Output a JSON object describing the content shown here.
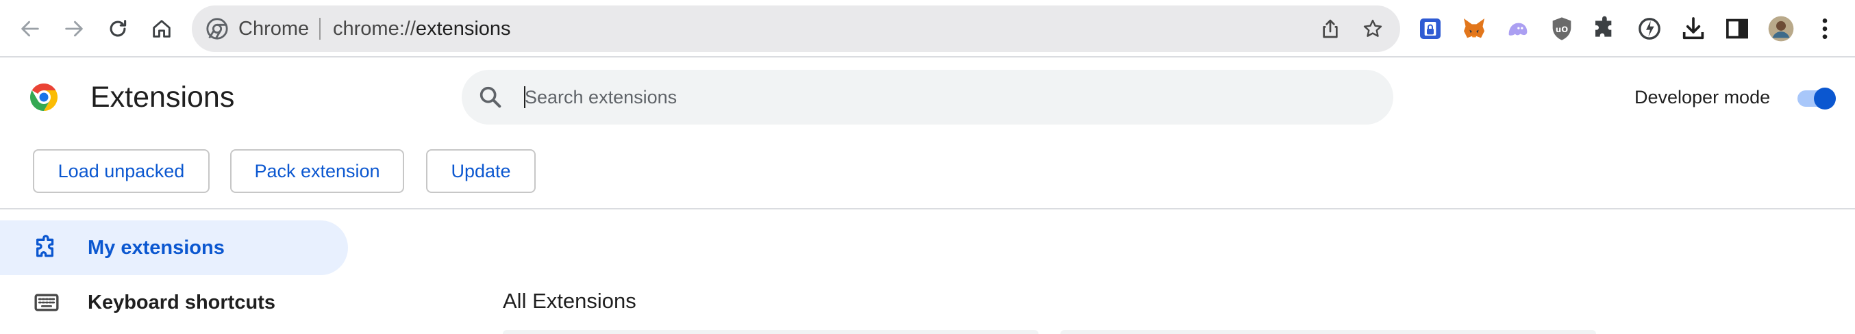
{
  "browser": {
    "omnibox": {
      "chip_label": "Chrome",
      "url_scheme": "chrome://",
      "url_host": "extensions"
    }
  },
  "page": {
    "title": "Extensions",
    "search": {
      "placeholder": "Search extensions",
      "value": ""
    },
    "developer_mode": {
      "label": "Developer mode",
      "enabled": true
    }
  },
  "actions": {
    "load_unpacked": "Load unpacked",
    "pack_extension": "Pack extension",
    "update": "Update"
  },
  "sidebar": {
    "items": [
      {
        "label": "My extensions",
        "icon": "extension-puzzle-icon",
        "active": true
      },
      {
        "label": "Keyboard shortcuts",
        "icon": "keyboard-icon",
        "active": false
      }
    ]
  },
  "main": {
    "section_title": "All Extensions"
  },
  "colors": {
    "accent": "#0b57d0",
    "active_nav_bg": "#e8f0fe",
    "toggle_track": "#a8c7fa",
    "search_bg": "#f1f3f4"
  }
}
